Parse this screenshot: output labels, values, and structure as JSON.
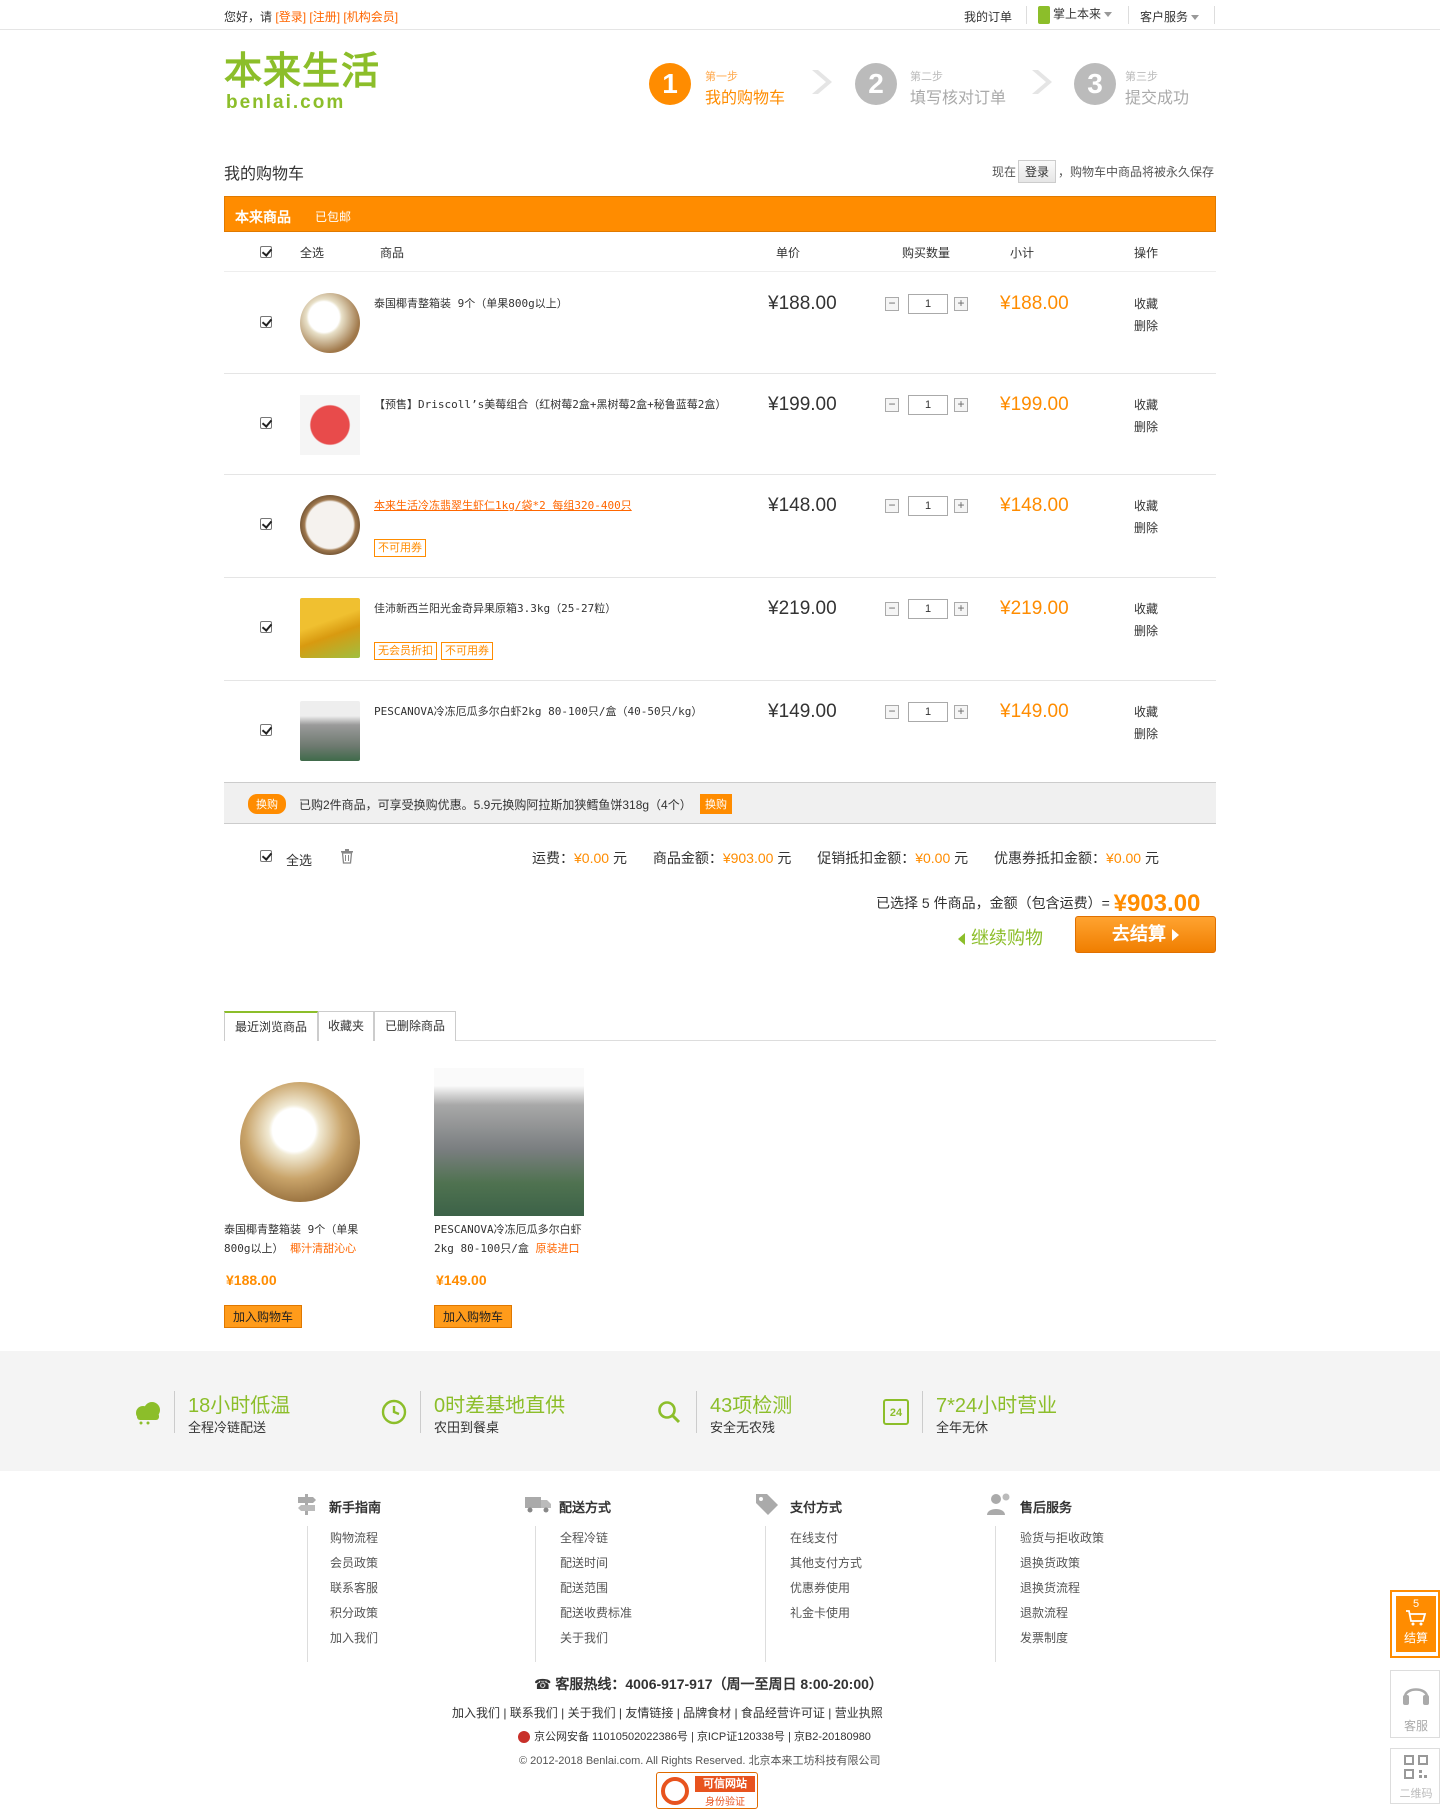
{
  "topbar": {
    "greeting": "您好，请",
    "login": "[登录]",
    "register": "[注册]",
    "org_member": "[机构会员]",
    "my_orders": "我的订单",
    "mobile": "掌上本来",
    "service": "客户服务"
  },
  "header": {
    "logo_cn": "本来生活",
    "logo_en": "benlai.com",
    "steps": [
      {
        "num": "1",
        "small": "第一步",
        "name": "我的购物车"
      },
      {
        "num": "2",
        "small": "第二步",
        "name": "填写核对订单"
      },
      {
        "num": "3",
        "small": "第三步",
        "name": "提交成功"
      }
    ]
  },
  "cart": {
    "title": "我的购物车",
    "save_prefix": "现在",
    "save_btn": "登录",
    "save_suffix": "，购物车中商品将被永久保存",
    "section": "本来商品",
    "shipping_badge": "已包邮",
    "columns": {
      "select_all": "全选",
      "product": "商品",
      "price": "单价",
      "qty": "购买数量",
      "subtotal": "小计",
      "ops": "操作"
    },
    "fav": "收藏",
    "del": "删除",
    "items": [
      {
        "name": "泰国椰青整箱装 9个（单果800g以上）",
        "price": "¥188.00",
        "qty": "1",
        "subtotal": "¥188.00",
        "tags": []
      },
      {
        "name": "【预售】Driscoll’s美莓组合（红树莓2盒+黑树莓2盒+秘鲁蓝莓2盒）",
        "price": "¥199.00",
        "qty": "1",
        "subtotal": "¥199.00",
        "tags": []
      },
      {
        "name": "本来生活冷冻翡翠生虾仁1kg/袋*2 每组320-400只",
        "price": "¥148.00",
        "qty": "1",
        "subtotal": "¥148.00",
        "tags": [
          "不可用券"
        ]
      },
      {
        "name": "佳沛新西兰阳光金奇异果原箱3.3kg（25-27粒）",
        "price": "¥219.00",
        "qty": "1",
        "subtotal": "¥219.00",
        "tags": [
          "无会员折扣",
          "不可用券"
        ]
      },
      {
        "name": "PESCANOVA冷冻厄瓜多尔白虾2kg 80-100只/盒（40-50只/kg）",
        "price": "¥149.00",
        "qty": "1",
        "subtotal": "¥149.00",
        "tags": []
      }
    ],
    "promo": {
      "badge": "换购",
      "text": "已购2件商品，可享受换购优惠。5.9元换购阿拉斯加狭鳕鱼饼318g（4个）",
      "btn": "换购"
    },
    "footer": {
      "select_all": "全选",
      "shipping_label": "运费：",
      "shipping": "¥0.00",
      "goods_label": "商品金额：",
      "goods": "¥903.00",
      "promo_label": "促销抵扣金额：",
      "promo": "¥0.00",
      "coupon_label": "优惠券抵扣金额：",
      "coupon": "¥0.00",
      "unit": "元",
      "selected_text": "已选择 5 件商品，金额（包含运费）=",
      "total": "¥903.00",
      "continue": "继续购物",
      "checkout": "去结算"
    }
  },
  "recent": {
    "tabs": [
      "最近浏览商品",
      "收藏夹",
      "已删除商品"
    ],
    "items": [
      {
        "name": "泰国椰青整箱装 9个（单果800g以上）",
        "slogan": "椰汁清甜沁心",
        "price": "¥188.00",
        "btn": "加入购物车"
      },
      {
        "name": "PESCANOVA冷冻厄瓜多尔白虾2kg 80-100只/盒",
        "slogan": "原装进口",
        "price": "¥149.00",
        "btn": "加入购物车"
      }
    ]
  },
  "features": [
    {
      "title": "18小时低温",
      "sub": "全程冷链配送",
      "icon": "cloud-icon"
    },
    {
      "title": "0时差基地直供",
      "sub": "农田到餐桌",
      "icon": "clock-icon"
    },
    {
      "title": "43项检测",
      "sub": "安全无农残",
      "icon": "search-icon"
    },
    {
      "title": "7*24小时营业",
      "sub": "全年无休",
      "icon": "calendar-icon",
      "badge": "24"
    }
  ],
  "footer": {
    "cols": [
      {
        "title": "新手指南",
        "links": [
          "购物流程",
          "会员政策",
          "联系客服",
          "积分政策",
          "加入我们"
        ]
      },
      {
        "title": "配送方式",
        "links": [
          "全程冷链",
          "配送时间",
          "配送范围",
          "配送收费标准",
          "关于我们"
        ]
      },
      {
        "title": "支付方式",
        "links": [
          "在线支付",
          "其他支付方式",
          "优惠券使用",
          "礼金卡使用"
        ]
      },
      {
        "title": "售后服务",
        "links": [
          "验货与拒收政策",
          "退换货政策",
          "退换货流程",
          "退款流程",
          "发票制度"
        ]
      }
    ],
    "hotline": "客服热线：4006-917-917（周一至周日 8:00-20:00）",
    "links": "加入我们 | 联系我们 | 关于我们 | 友情链接 | 品牌食材 | 食品经营许可证 | 营业执照",
    "icp": "京公网安备 11010502022386号 | 京ICP证120338号 | 京B2-20180980",
    "copyright": "© 2012-2018 Benlai.com. All Rights Reserved. 北京本来工坊科技有限公司",
    "trust_line1": "可信网站",
    "trust_line2": "身份验证"
  },
  "float": {
    "cart_count": "5",
    "cart_label": "结算",
    "service_label": "客服",
    "qr_label": "二维码"
  },
  "colors": {
    "brand_green": "#8cbe2a",
    "accent_orange": "#ff8c00"
  }
}
